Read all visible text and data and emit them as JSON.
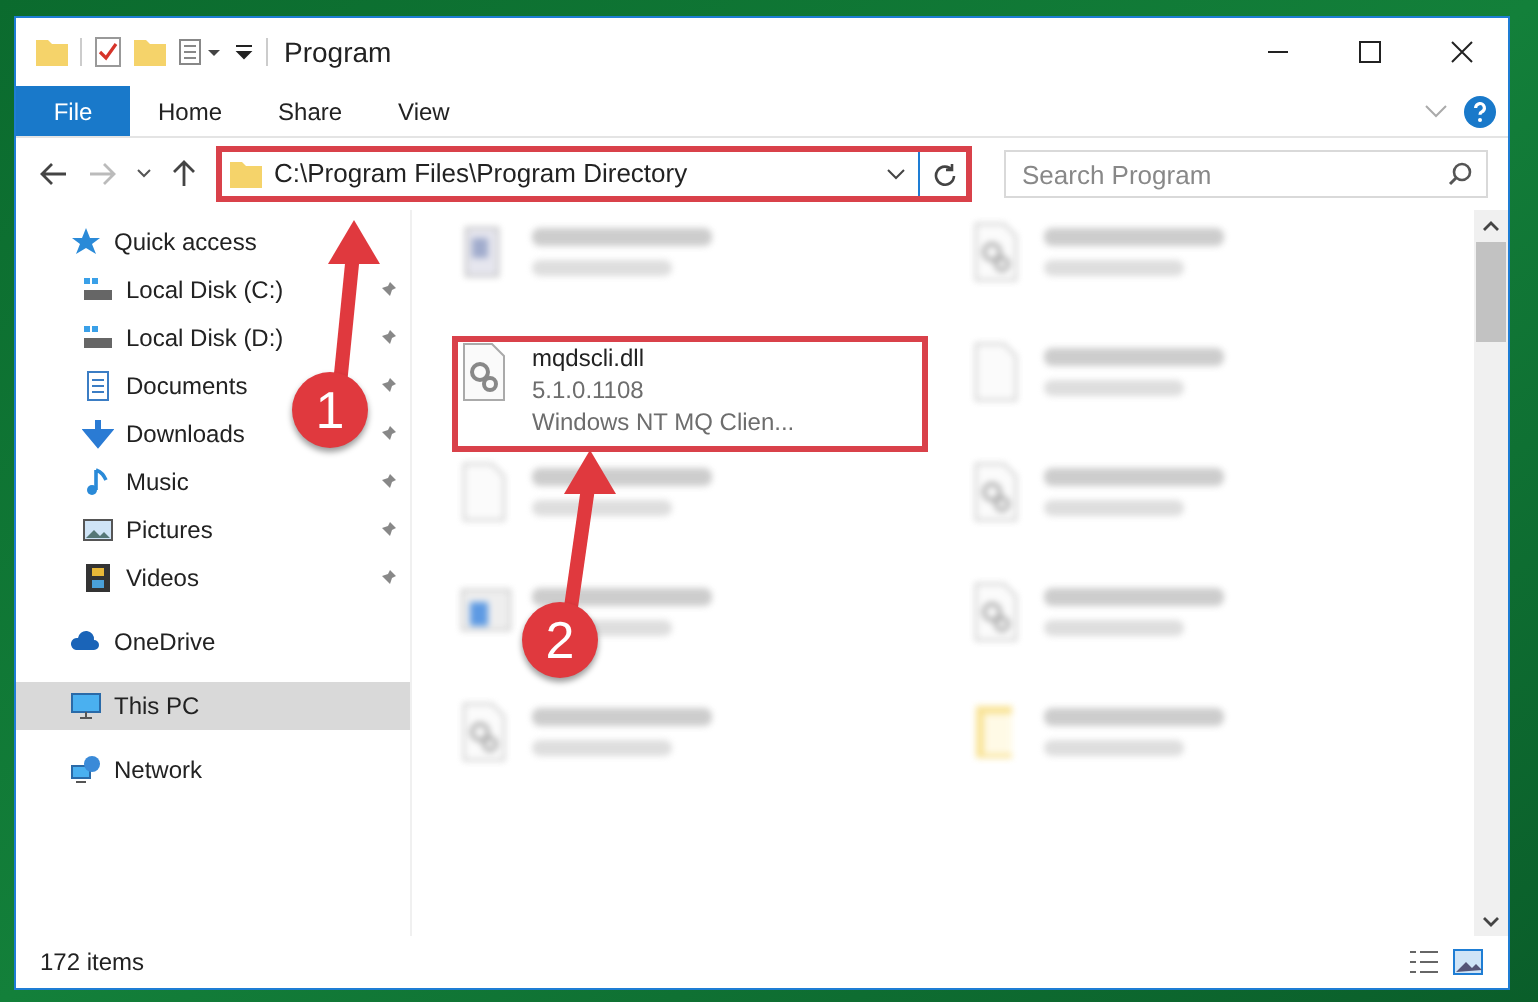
{
  "window": {
    "title": "Program"
  },
  "ribbon_tabs": [
    {
      "label": "File",
      "selected": true
    },
    {
      "label": "Home",
      "selected": false
    },
    {
      "label": "Share",
      "selected": false
    },
    {
      "label": "View",
      "selected": false
    }
  ],
  "address_bar": {
    "value": "C:\\Program Files\\Program Directory",
    "highlighted": true
  },
  "search": {
    "placeholder": "Search Program"
  },
  "sidebar": {
    "items": [
      {
        "label": "Quick access",
        "kind": "star",
        "selected": false,
        "children": [
          {
            "label": "Local Disk (C:)",
            "kind": "disk",
            "pinned": true,
            "selected": false
          },
          {
            "label": "Local Disk (D:)",
            "kind": "disk",
            "pinned": true,
            "selected": false
          },
          {
            "label": "Documents",
            "kind": "doc",
            "pinned": true,
            "selected": false
          },
          {
            "label": "Downloads",
            "kind": "download",
            "pinned": true,
            "selected": false
          },
          {
            "label": "Music",
            "kind": "music",
            "pinned": true,
            "selected": false
          },
          {
            "label": "Pictures",
            "kind": "picture",
            "pinned": true,
            "selected": false
          },
          {
            "label": "Videos",
            "kind": "video",
            "pinned": true,
            "selected": false
          }
        ]
      },
      {
        "label": "OneDrive",
        "kind": "cloud",
        "selected": false
      },
      {
        "label": "This PC",
        "kind": "pc",
        "selected": true
      },
      {
        "label": "Network",
        "kind": "network",
        "selected": false
      }
    ]
  },
  "files": [
    {
      "kind": "exe",
      "blurred": true,
      "highlighted": false
    },
    {
      "kind": "dll",
      "blurred": true,
      "highlighted": false
    },
    {
      "kind": "dll",
      "name": "mqdscli.dll",
      "lines": [
        "5.1.0.1108",
        "Windows NT MQ Clien..."
      ],
      "blurred": false,
      "highlighted": true
    },
    {
      "kind": "blank",
      "blurred": true,
      "highlighted": false
    },
    {
      "kind": "blank",
      "blurred": true,
      "highlighted": false
    },
    {
      "kind": "dll",
      "blurred": true,
      "highlighted": false
    },
    {
      "kind": "installer",
      "blurred": true,
      "highlighted": false
    },
    {
      "kind": "dll",
      "blurred": true,
      "highlighted": false
    },
    {
      "kind": "dll",
      "blurred": true,
      "highlighted": false
    },
    {
      "kind": "folder",
      "blurred": true,
      "highlighted": false
    }
  ],
  "status_bar": {
    "item_count": "172 items"
  },
  "callouts": [
    "1",
    "2"
  ]
}
